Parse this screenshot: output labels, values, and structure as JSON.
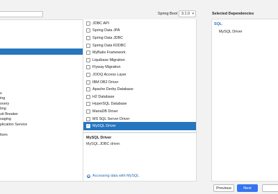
{
  "header": {
    "spring_boot_label": "Spring Boot",
    "spring_boot_version": "3.1.0",
    "selected_title": "Selected Dependencies"
  },
  "categories": [
    "",
    "",
    "",
    "",
    "",
    "",
    "",
    "",
    "",
    "",
    "",
    "",
    "",
    "",
    "",
    "",
    "",
    "",
    "",
    "",
    "",
    ""
  ],
  "categories_visible": [
    {
      "label": "",
      "selected": false
    },
    {
      "label": "",
      "selected": false
    },
    {
      "label": "",
      "selected": false
    },
    {
      "label": "",
      "selected": false
    },
    {
      "label": "",
      "selected": true
    },
    {
      "label": "",
      "selected": false
    },
    {
      "label": "",
      "selected": false
    },
    {
      "label": "",
      "selected": false
    },
    {
      "label": "",
      "selected": false
    },
    {
      "label": "",
      "selected": false
    },
    {
      "label": "",
      "selected": false
    },
    {
      "label": "",
      "selected": false
    },
    {
      "label": "s",
      "selected": false
    },
    {
      "label": "ing",
      "selected": false
    },
    {
      "label": "overy",
      "selected": false
    },
    {
      "label": "ting",
      "selected": false
    },
    {
      "label": "uit Breaker",
      "selected": false
    },
    {
      "label": "saging",
      "selected": false
    },
    {
      "label": "plication Service",
      "selected": false
    },
    {
      "label": "",
      "selected": false
    },
    {
      "label": "form",
      "selected": false
    }
  ],
  "dependencies": [
    {
      "label": "JDBC API",
      "checked": false
    },
    {
      "label": "Spring Data JPA",
      "checked": false
    },
    {
      "label": "Spring Data JDBC",
      "checked": false
    },
    {
      "label": "Spring Data R2DBC",
      "checked": false
    },
    {
      "label": "MyBatis Framework",
      "checked": false
    },
    {
      "label": "Liquibase Migration",
      "checked": false
    },
    {
      "label": "Flyway Migration",
      "checked": false
    },
    {
      "label": "JOOQ Access Layer",
      "checked": false
    },
    {
      "label": "IBM DB2 Driver",
      "checked": false
    },
    {
      "label": "Apache Derby Database",
      "checked": false
    },
    {
      "label": "H2 Database",
      "checked": false
    },
    {
      "label": "HyperSQL Database",
      "checked": false
    },
    {
      "label": "MariaDB Driver",
      "checked": false
    },
    {
      "label": "MS SQL Server Driver",
      "checked": false
    },
    {
      "label": "MySQL Driver",
      "checked": true
    }
  ],
  "description": {
    "title": "MySQL Driver",
    "text": "MySQL JDBC driver.",
    "link": "Accessing data with MySQL"
  },
  "selected": {
    "group": "SQL",
    "items": [
      "MySQL Driver"
    ]
  },
  "buttons": {
    "previous": "Previous",
    "next": "Next"
  },
  "colors": {
    "accent": "#2675bf",
    "primary_button": "#3574f0"
  }
}
